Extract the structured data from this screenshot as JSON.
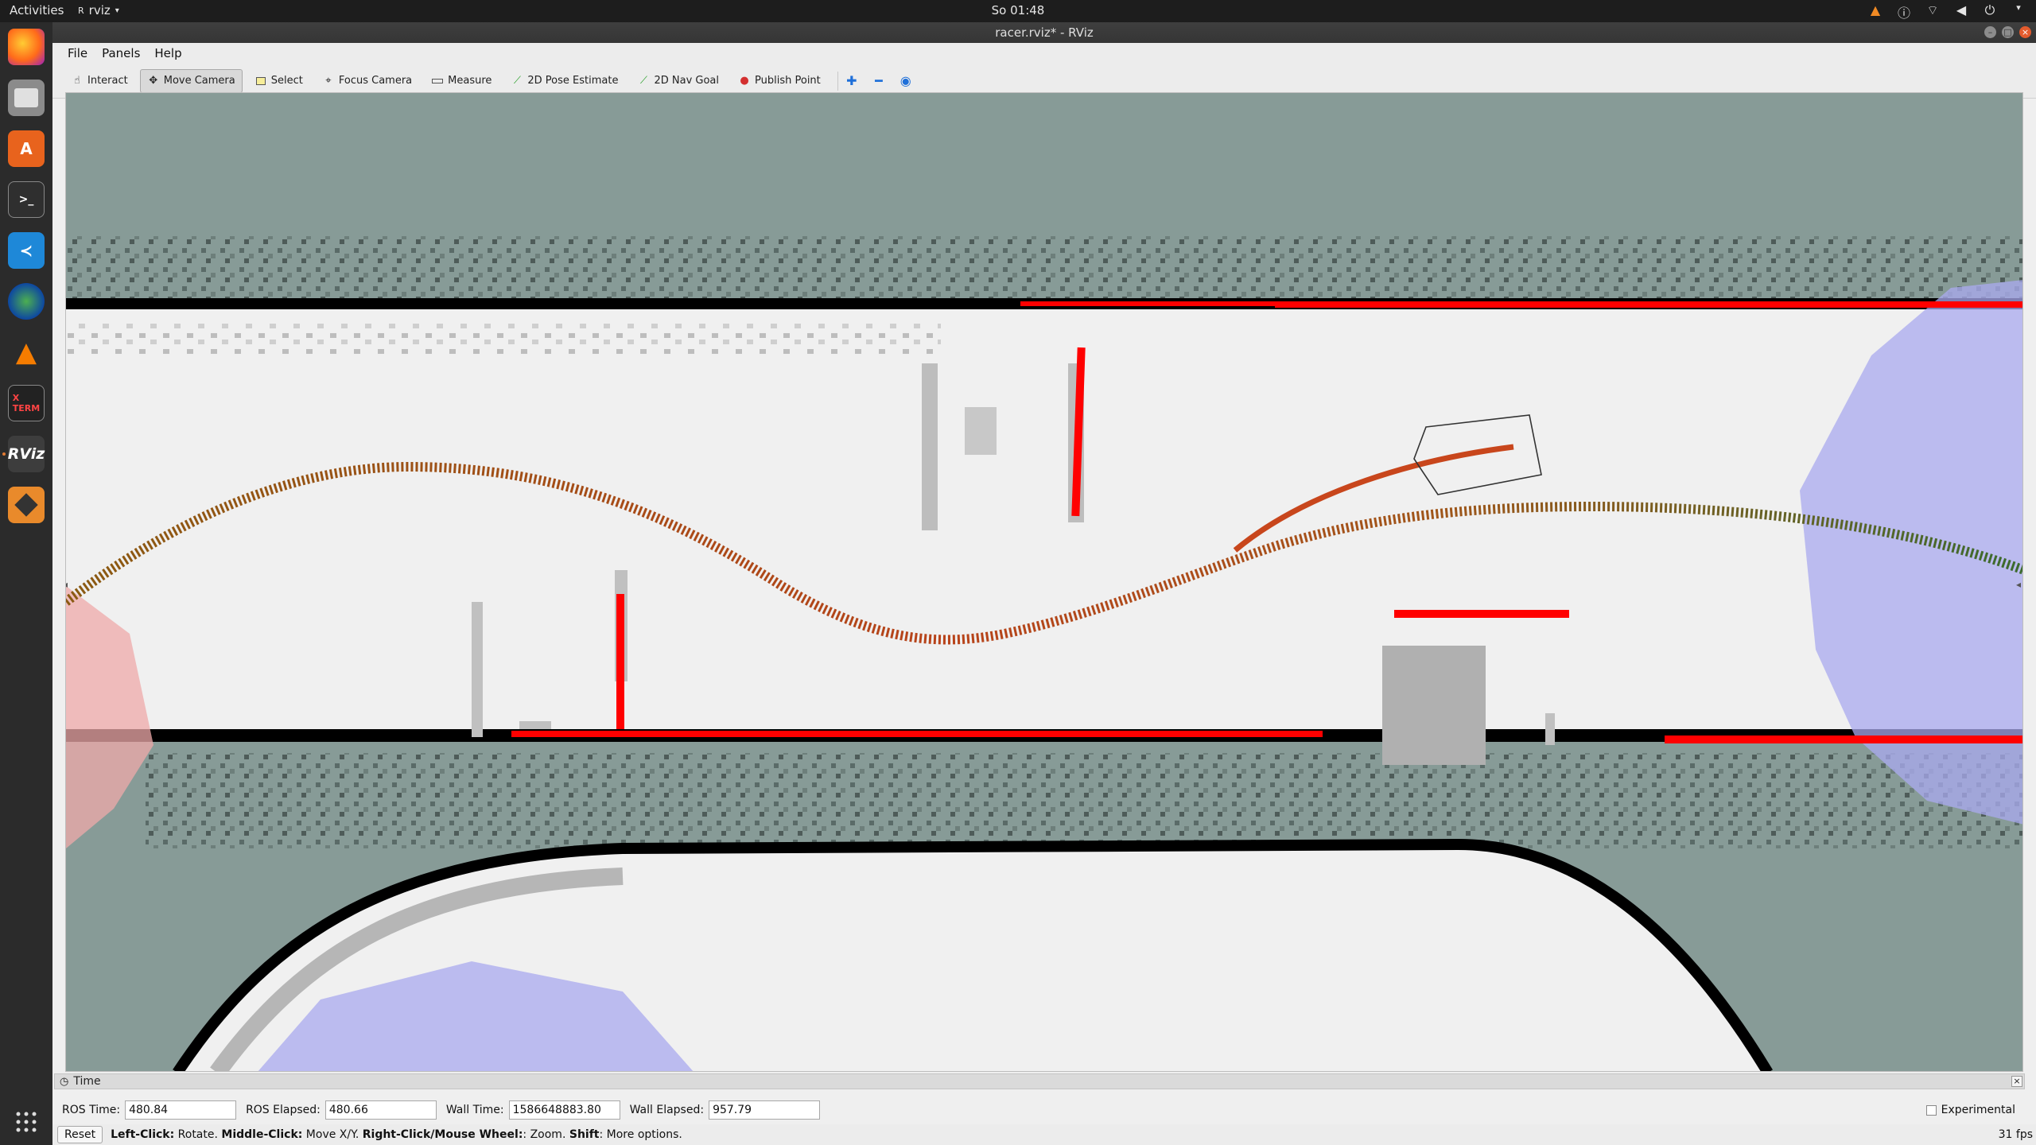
{
  "topbar": {
    "activities": "Activities",
    "app_name": "rviz",
    "clock": "So 01:48"
  },
  "dock": {
    "items": [
      {
        "name": "firefox-icon",
        "glyph": "🦊"
      },
      {
        "name": "files-icon",
        "glyph": "▤"
      },
      {
        "name": "software-icon",
        "glyph": "A"
      },
      {
        "name": "terminal-icon",
        "glyph": ">_"
      },
      {
        "name": "vscode-icon",
        "glyph": "≺"
      },
      {
        "name": "browser-icon",
        "glyph": "◉"
      },
      {
        "name": "vlc-icon",
        "glyph": "▲"
      },
      {
        "name": "xterm-icon",
        "glyph": "X"
      },
      {
        "name": "rviz-icon",
        "glyph": "RViz"
      },
      {
        "name": "layers-icon",
        "glyph": "◆"
      }
    ],
    "show_apps_glyph": "⋮⋮⋮"
  },
  "window": {
    "title": "racer.rviz* - RViz"
  },
  "menubar": {
    "file": "File",
    "panels": "Panels",
    "help": "Help"
  },
  "toolbar": {
    "interact": "Interact",
    "move_camera": "Move Camera",
    "select": "Select",
    "focus_camera": "Focus Camera",
    "measure": "Measure",
    "pose_estimate": "2D Pose Estimate",
    "nav_goal": "2D Nav Goal",
    "publish_point": "Publish Point"
  },
  "time_panel": {
    "title": "Time",
    "ros_time_label": "ROS Time:",
    "ros_time": "480.84",
    "ros_elapsed_label": "ROS Elapsed:",
    "ros_elapsed": "480.66",
    "wall_time_label": "Wall Time:",
    "wall_time": "1586648883.80",
    "wall_elapsed_label": "Wall Elapsed:",
    "wall_elapsed": "957.79",
    "experimental": "Experimental"
  },
  "statusbar": {
    "reset": "Reset",
    "hint_left_bold": "Left-Click:",
    "hint_left": " Rotate. ",
    "hint_middle_bold": "Middle-Click:",
    "hint_middle": " Move X/Y. ",
    "hint_right_bold": "Right-Click/Mouse Wheel:",
    "hint_right": ": Zoom. ",
    "hint_shift_bold": "Shift",
    "hint_shift": ": More options.",
    "fps": "31 fps"
  },
  "colors": {
    "map_unknown": "#879b97",
    "map_free": "#f0f0f0",
    "wall": "#000000",
    "laser": "#ff0000",
    "costmap_blue": "#a9a9ef",
    "costmap_red": "#efa9a9"
  }
}
